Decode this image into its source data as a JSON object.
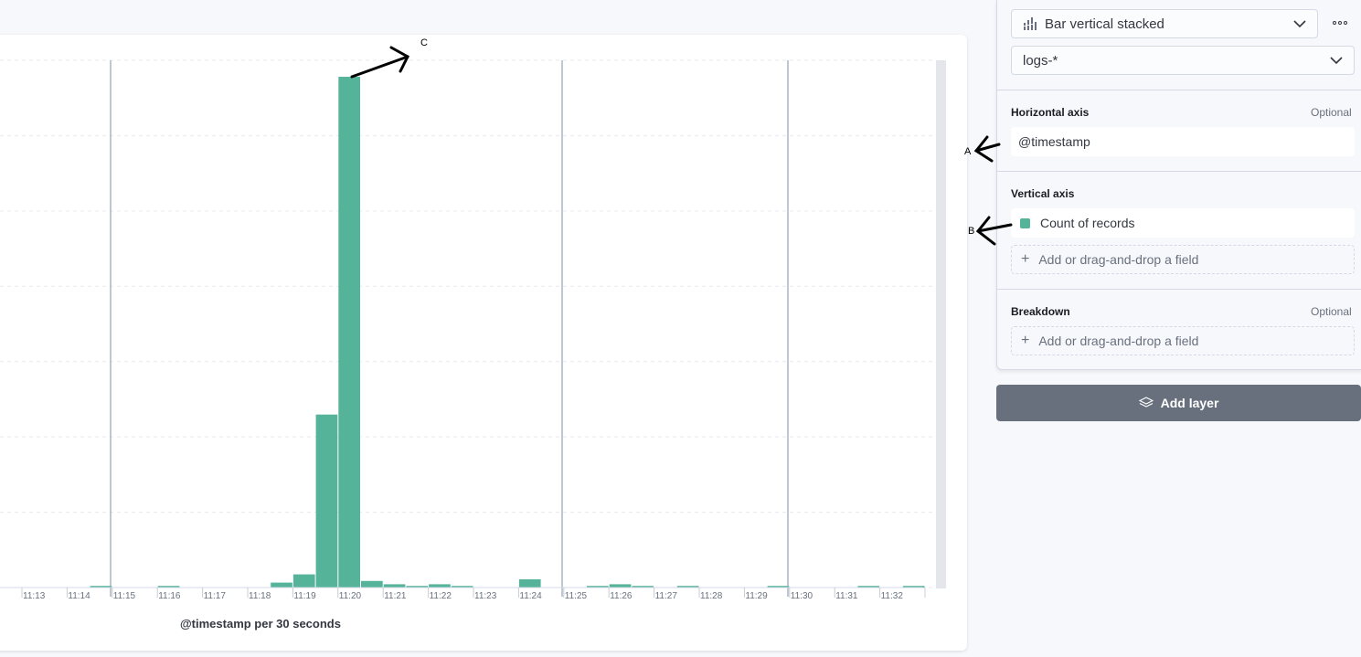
{
  "chart_data": {
    "type": "bar",
    "xlabel": "@timestamp per 30 seconds",
    "x_ticks": [
      "11:13",
      "11:14",
      "11:15",
      "11:16",
      "11:17",
      "11:18",
      "11:19",
      "11:20",
      "11:21",
      "11:22",
      "11:23",
      "11:24",
      "11:25",
      "11:26",
      "11:27",
      "11:28",
      "11:29",
      "11:30",
      "11:31",
      "11:32"
    ],
    "bar_start": "11:12:30",
    "bar_interval_seconds": 30,
    "values": [
      0,
      0,
      0,
      0,
      1,
      0,
      0,
      1,
      0,
      0,
      0,
      0,
      3,
      8,
      105,
      310,
      4,
      2,
      1,
      2,
      1,
      0,
      0,
      5,
      0,
      0,
      1,
      2,
      1,
      0,
      1,
      0,
      0,
      0,
      1,
      0,
      0,
      0,
      1,
      0,
      1,
      0
    ],
    "ylim": [
      0,
      320
    ],
    "series": [
      {
        "color": "#54b399"
      }
    ],
    "grid": true
  },
  "chart_type_select": {
    "label": "Bar vertical stacked",
    "icon": "bar-vertical-stacked-icon"
  },
  "index_select": {
    "label": "logs-*"
  },
  "horizontal_axis": {
    "title": "Horizontal axis",
    "optional": "Optional",
    "field": "@timestamp"
  },
  "vertical_axis": {
    "title": "Vertical axis",
    "field": "Count of records",
    "field_color": "#54b399",
    "dropzone": "Add or drag-and-drop a field"
  },
  "breakdown": {
    "title": "Breakdown",
    "optional": "Optional",
    "dropzone": "Add or drag-and-drop a field"
  },
  "add_layer": {
    "label": "Add layer"
  },
  "annotations": {
    "a": "A",
    "b": "B",
    "c": "C"
  }
}
